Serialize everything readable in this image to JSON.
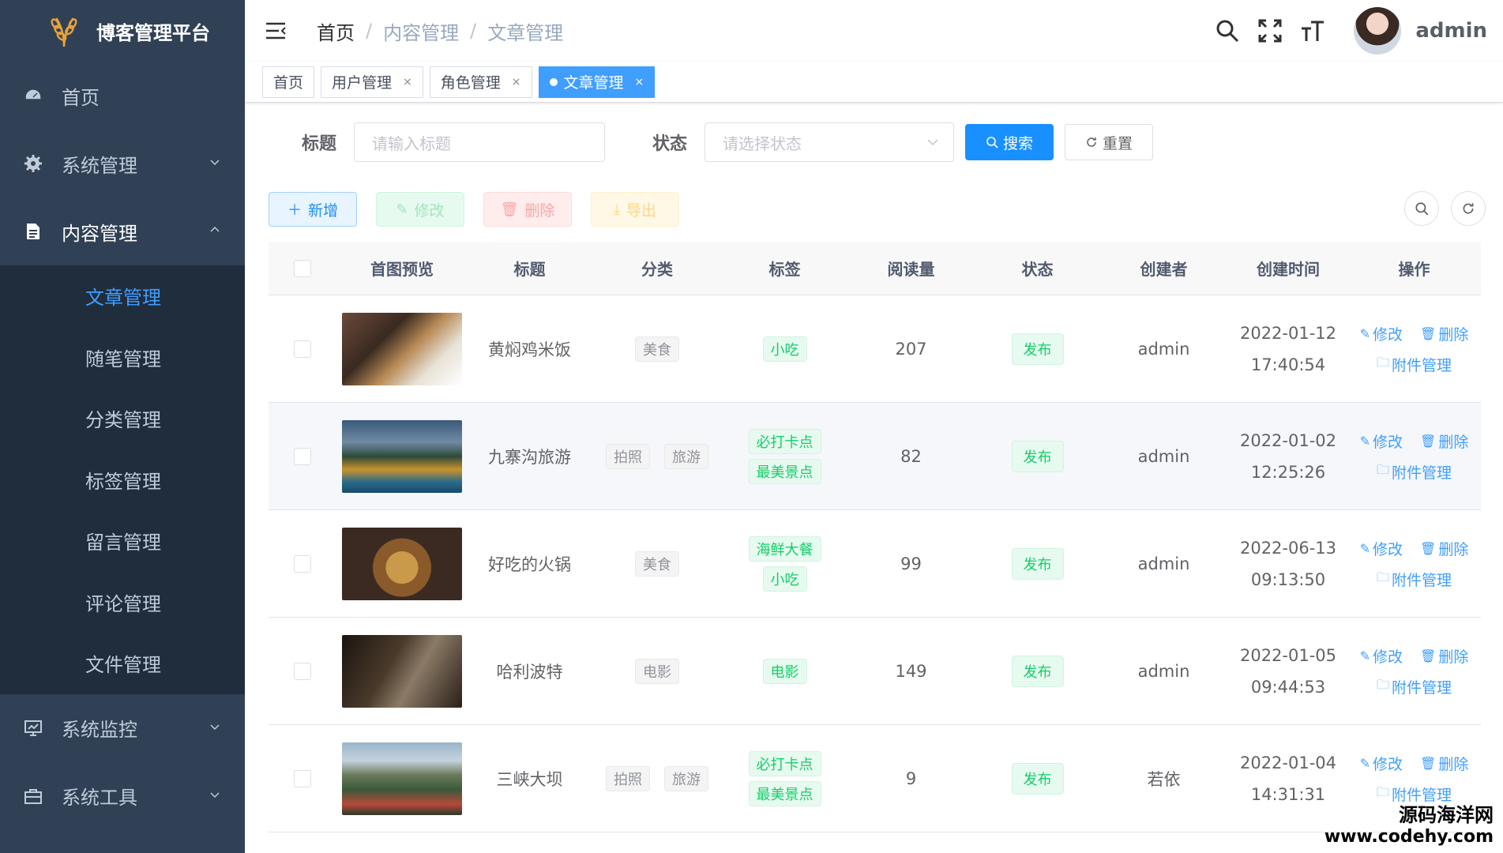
{
  "brand": {
    "title": "博客管理平台"
  },
  "sidebar": {
    "items": [
      {
        "label": "首页"
      },
      {
        "label": "系统管理"
      },
      {
        "label": "内容管理"
      },
      {
        "label": "系统监控"
      },
      {
        "label": "系统工具"
      }
    ],
    "submenu": [
      {
        "label": "文章管理"
      },
      {
        "label": "随笔管理"
      },
      {
        "label": "分类管理"
      },
      {
        "label": "标签管理"
      },
      {
        "label": "留言管理"
      },
      {
        "label": "评论管理"
      },
      {
        "label": "文件管理"
      }
    ]
  },
  "header": {
    "breadcrumb": [
      "首页",
      "内容管理",
      "文章管理"
    ],
    "separator": "/",
    "username": "admin"
  },
  "tags_view": [
    {
      "label": "首页"
    },
    {
      "label": "用户管理",
      "close": "×"
    },
    {
      "label": "角色管理",
      "close": "×"
    },
    {
      "label": "文章管理",
      "close": "×"
    }
  ],
  "search": {
    "title_label": "标题",
    "title_placeholder": "请输入标题",
    "status_label": "状态",
    "status_placeholder": "请选择状态",
    "search_btn": "搜索",
    "reset_btn": "重置"
  },
  "toolbar": {
    "add": "新增",
    "edit": "修改",
    "delete": "删除",
    "export": "导出"
  },
  "table": {
    "columns": [
      "首图预览",
      "标题",
      "分类",
      "标签",
      "阅读量",
      "状态",
      "创建者",
      "创建时间",
      "操作"
    ],
    "op_edit": "修改",
    "op_delete": "删除",
    "op_attach": "附件管理",
    "rows": [
      {
        "title": "黄焖鸡米饭",
        "categories": [
          "美食"
        ],
        "tags": [
          "小吃"
        ],
        "reads": "207",
        "status": "发布",
        "creator": "admin",
        "date": "2022-01-12",
        "time": "17:40:54"
      },
      {
        "title": "九寨沟旅游",
        "categories": [
          "拍照",
          "旅游"
        ],
        "tags": [
          "必打卡点",
          "最美景点"
        ],
        "reads": "82",
        "status": "发布",
        "creator": "admin",
        "date": "2022-01-02",
        "time": "12:25:26"
      },
      {
        "title": "好吃的火锅",
        "categories": [
          "美食"
        ],
        "tags": [
          "海鲜大餐",
          "小吃"
        ],
        "reads": "99",
        "status": "发布",
        "creator": "admin",
        "date": "2022-06-13",
        "time": "09:13:50"
      },
      {
        "title": "哈利波特",
        "categories": [
          "电影"
        ],
        "tags": [
          "电影"
        ],
        "reads": "149",
        "status": "发布",
        "creator": "admin",
        "date": "2022-01-05",
        "time": "09:44:53"
      },
      {
        "title": "三峡大坝",
        "categories": [
          "拍照",
          "旅游"
        ],
        "tags": [
          "必打卡点",
          "最美景点"
        ],
        "reads": "9",
        "status": "发布",
        "creator": "若依",
        "date": "2022-01-04",
        "time": "14:31:31"
      }
    ]
  },
  "watermark": {
    "line1": "源码海洋网",
    "line2": "www.codehy.com"
  }
}
